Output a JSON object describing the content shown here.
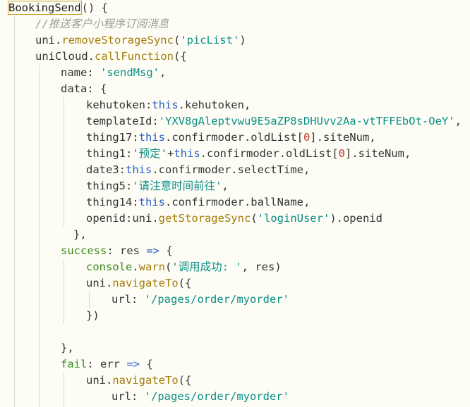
{
  "code": {
    "l1": [
      "BookingSend",
      "() {"
    ],
    "l2": [
      "//推送客户小程序订阅消息"
    ],
    "l3": [
      "uni.",
      "removeStorageSync",
      "(",
      "'picList'",
      ")"
    ],
    "l4": [
      "uniCloud.",
      "callFunction",
      "({"
    ],
    "l5": [
      "name: ",
      "'sendMsg'",
      ","
    ],
    "l6": [
      "data: {"
    ],
    "l7": [
      "kehutoken:",
      "this",
      ".kehutoken,"
    ],
    "l8": [
      "templateId:",
      "'YXV8gAleptvwu9E5aZP8sDHUvv2Aa-vtTFFEbOt-OeY'",
      ","
    ],
    "l9": [
      "thing17:",
      "this",
      ".confirmoder.oldList[",
      "0",
      "].siteNum,"
    ],
    "l10": [
      "thing1:",
      "'预定'",
      "+",
      "this",
      ".confirmoder.oldList[",
      "0",
      "].siteNum,"
    ],
    "l11": [
      "date3:",
      "this",
      ".confirmoder.selectTime,"
    ],
    "l12": [
      "thing5:",
      "'请注意时间前往'",
      ","
    ],
    "l13": [
      "thing14:",
      "this",
      ".confirmoder.ballName,"
    ],
    "l14": [
      "openid:uni.",
      "getStorageSync",
      "(",
      "'loginUser'",
      ").openid"
    ],
    "l15": [
      "},"
    ],
    "l16": [
      "success",
      ": res ",
      "=>",
      " {"
    ],
    "l17": [
      "console",
      ".",
      "warn",
      "(",
      "'调用成功: '",
      ", res)"
    ],
    "l18": [
      "uni.",
      "navigateTo",
      "({"
    ],
    "l19": [
      "url: ",
      "'/pages/order/myorder'"
    ],
    "l20": [
      "})"
    ],
    "l21": [
      ""
    ],
    "l22": [
      "},"
    ],
    "l23": [
      "fail",
      ": err ",
      "=>",
      " {"
    ],
    "l24": [
      "uni.",
      "navigateTo",
      "({"
    ],
    "l25": [
      "url: ",
      "'/pages/order/myorder'"
    ],
    "l26": [
      "})"
    ]
  },
  "colors": {
    "background": "#fdfdf6",
    "keyword": "#2a5fc4",
    "string": "#0a8f86",
    "method": "#a47c0a",
    "property-green": "#3a8a1c",
    "comment": "#9aa09a",
    "number": "#c0392b"
  }
}
